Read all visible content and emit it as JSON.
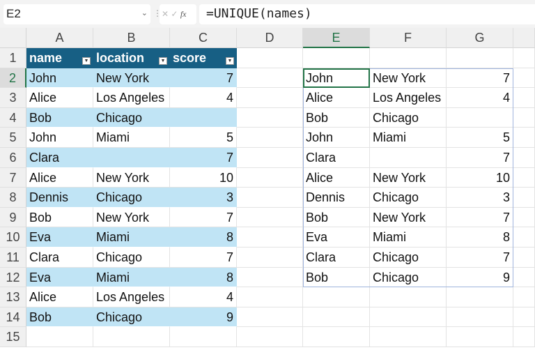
{
  "formula_bar": {
    "name_box": "E2",
    "formula": "=UNIQUE(names)",
    "fx": "fx"
  },
  "columns": [
    "A",
    "B",
    "C",
    "D",
    "E",
    "F",
    "G"
  ],
  "rows": [
    "1",
    "2",
    "3",
    "4",
    "5",
    "6",
    "7",
    "8",
    "9",
    "10",
    "11",
    "12",
    "13",
    "14",
    "15"
  ],
  "table": {
    "headers": [
      "name",
      "location",
      "score"
    ],
    "rows": [
      [
        "John",
        "New York",
        "7"
      ],
      [
        "Alice",
        "Los Angeles",
        "4"
      ],
      [
        "Bob",
        "Chicago",
        ""
      ],
      [
        "John",
        "Miami",
        "5"
      ],
      [
        "Clara",
        "",
        "7"
      ],
      [
        "Alice",
        "New York",
        "10"
      ],
      [
        "Dennis",
        "Chicago",
        "3"
      ],
      [
        "Bob",
        "New York",
        "7"
      ],
      [
        "Eva",
        "Miami",
        "8"
      ],
      [
        "Clara",
        "Chicago",
        "7"
      ],
      [
        "Eva",
        "Miami",
        "8"
      ],
      [
        "Alice",
        "Los Angeles",
        "4"
      ],
      [
        "Bob",
        "Chicago",
        "9"
      ]
    ]
  },
  "unique": [
    [
      "John",
      "New York",
      "7"
    ],
    [
      "Alice",
      "Los Angeles",
      "4"
    ],
    [
      "Bob",
      "Chicago",
      ""
    ],
    [
      "John",
      "Miami",
      "5"
    ],
    [
      "Clara",
      "",
      "7"
    ],
    [
      "Alice",
      "New York",
      "10"
    ],
    [
      "Dennis",
      "Chicago",
      "3"
    ],
    [
      "Bob",
      "New York",
      "7"
    ],
    [
      "Eva",
      "Miami",
      "8"
    ],
    [
      "Clara",
      "Chicago",
      "7"
    ],
    [
      "Bob",
      "Chicago",
      "9"
    ]
  ]
}
